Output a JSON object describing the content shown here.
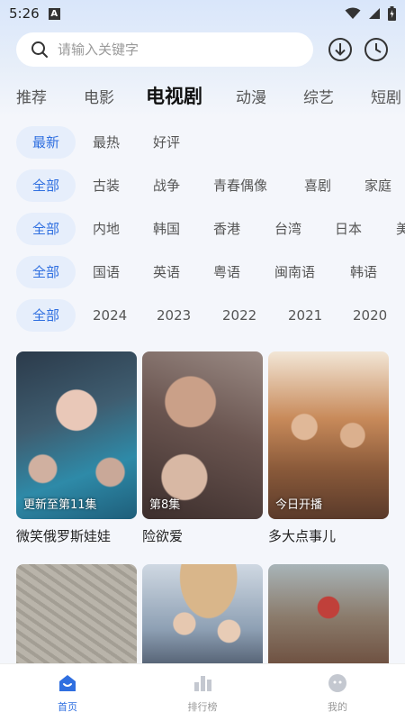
{
  "status_bar": {
    "time": "5:26",
    "notification_letter": "A"
  },
  "search": {
    "placeholder": "请输入关键字",
    "value": "",
    "icon": "search-icon"
  },
  "header_actions": {
    "download_icon": "download-icon",
    "history_icon": "clock-icon"
  },
  "tabs": [
    "推荐",
    "电影",
    "电视剧",
    "动漫",
    "综艺",
    "短剧"
  ],
  "active_tab": "电视剧",
  "filters": {
    "sort": [
      "最新",
      "最热",
      "好评"
    ],
    "type": [
      "全部",
      "古装",
      "战争",
      "青春偶像",
      "喜剧",
      "家庭"
    ],
    "region": [
      "全部",
      "内地",
      "韩国",
      "香港",
      "台湾",
      "日本",
      "美"
    ],
    "language": [
      "全部",
      "国语",
      "英语",
      "粤语",
      "闽南语",
      "韩语"
    ],
    "year": [
      "全部",
      "2024",
      "2023",
      "2022",
      "2021",
      "2020"
    ]
  },
  "cards": [
    {
      "title": "微笑俄罗斯娃娃",
      "badge": "更新至第11集"
    },
    {
      "title": "险欲爱",
      "badge": "第8集"
    },
    {
      "title": "多大点事儿",
      "badge": "今日开播"
    }
  ],
  "bottom_nav": [
    {
      "label": "首页",
      "icon": "home-icon",
      "active": true
    },
    {
      "label": "排行榜",
      "icon": "bar-chart-icon",
      "active": false
    },
    {
      "label": "我的",
      "icon": "profile-icon",
      "active": false
    }
  ],
  "colors": {
    "accent": "#2f6fe0",
    "chip_bg": "#e6eefb",
    "background": "#f4f6fb"
  }
}
